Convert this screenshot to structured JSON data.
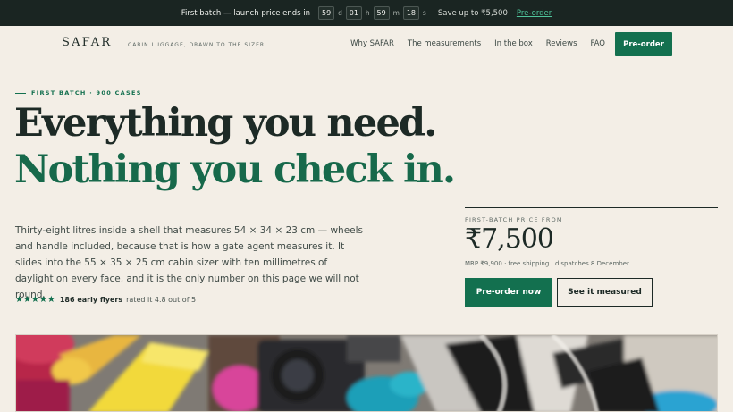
{
  "promo": {
    "lead": "First batch — launch price ends in",
    "countdown": [
      {
        "value": "59",
        "unit": "d"
      },
      {
        "value": "01",
        "unit": "h"
      },
      {
        "value": "59",
        "unit": "m"
      },
      {
        "value": "18",
        "unit": "s"
      }
    ],
    "save": "Save up to ₹5,500",
    "cta": "Pre-order"
  },
  "nav": {
    "logo": "SAFAR",
    "tagline": "CABIN LUGGAGE, DRAWN TO THE SIZER",
    "links": [
      "Why SAFAR",
      "The measurements",
      "In the box",
      "Reviews",
      "FAQ"
    ],
    "cta": "Pre-order"
  },
  "hero": {
    "eyebrow": "FIRST BATCH · 900 CASES",
    "headline_line1": "Everything you need.",
    "headline_line2": "Nothing you check in.",
    "body": "Thirty-eight litres inside a shell that measures 54 × 34 × 23 cm — wheels and handle included, because that is how a gate agent measures it. It slides into the 55 × 35 × 25 cm cabin sizer with ten millimetres of daylight on every face, and it is the only number on this page we will not round.",
    "rating": {
      "stars": "★★★★★",
      "count": "186 early flyers",
      "text": "rated it 4.8 out of 5",
      "score": 4.8
    }
  },
  "pricing": {
    "label": "FIRST-BATCH PRICE FROM",
    "price": "₹7,500",
    "meta": "MRP ₹9,900 · free shipping · dispatches 8 December",
    "primary_cta": "Pre-order now",
    "secondary_cta": "See it measured"
  },
  "colors": {
    "accent": "#13704f",
    "topbar": "#1a2522",
    "background": "#f3eee6"
  }
}
